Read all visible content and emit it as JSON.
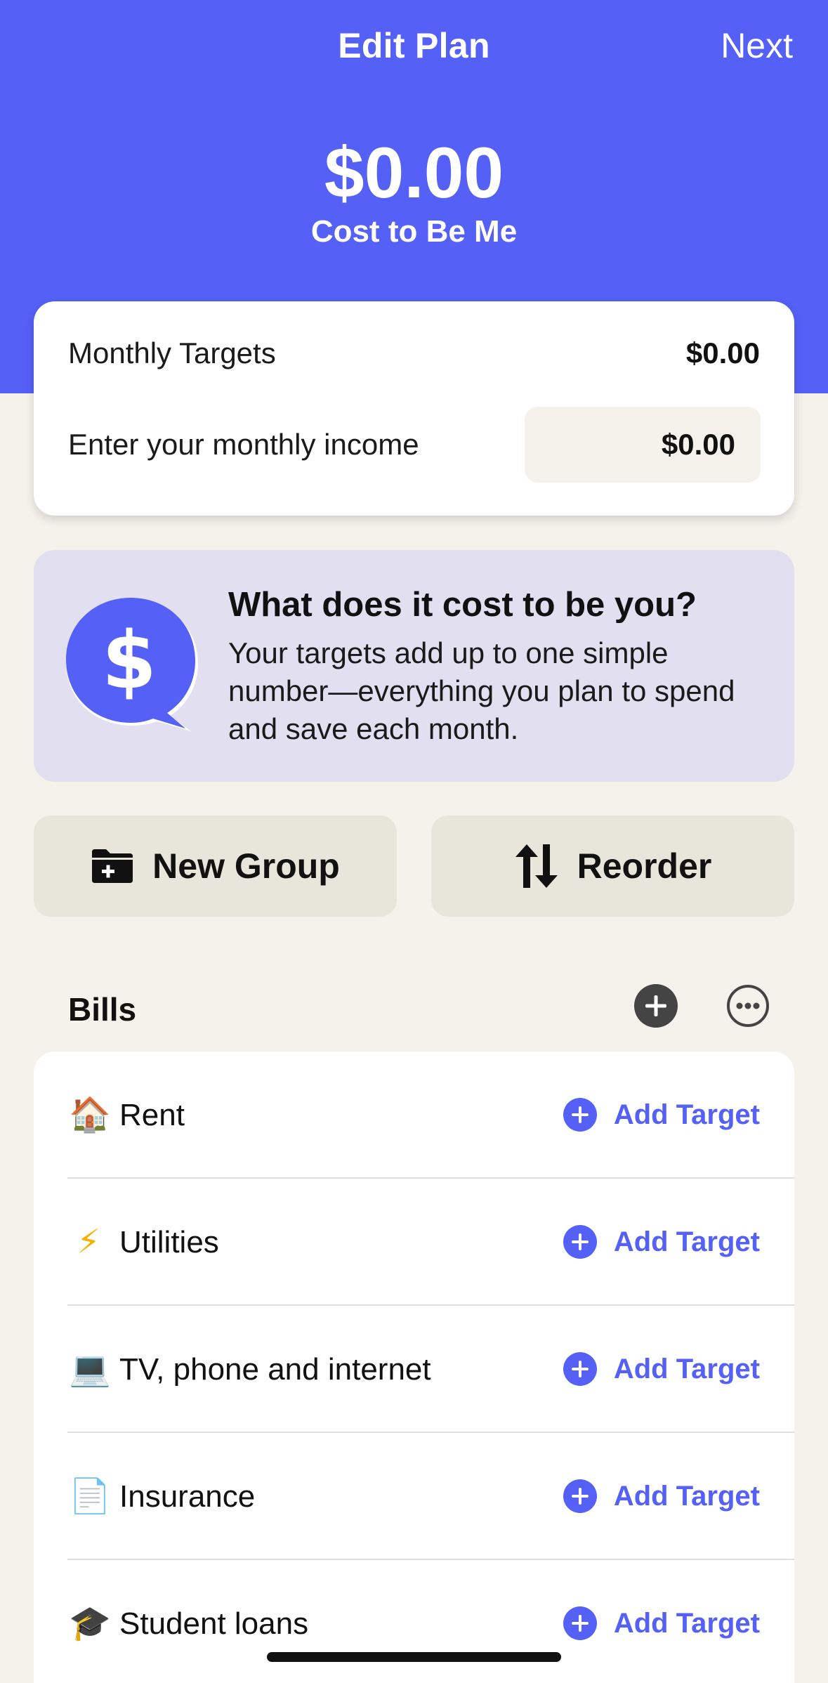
{
  "nav": {
    "title": "Edit Plan",
    "next_label": "Next"
  },
  "hero": {
    "amount": "$0.00",
    "label": "Cost to Be Me"
  },
  "summary": {
    "monthly_targets_label": "Monthly Targets",
    "monthly_targets_value": "$0.00",
    "income_label": "Enter your monthly income",
    "income_value": "$0.00"
  },
  "info": {
    "icon": "dollar-speech-bubble-icon",
    "title": "What does it cost to be you?",
    "body": "Your targets add up to one simple number—everything you plan to spend and save each month."
  },
  "actions": {
    "new_group_label": "New Group",
    "reorder_label": "Reorder"
  },
  "group": {
    "title": "Bills",
    "items": [
      {
        "emoji": "🏠",
        "name": "Rent",
        "action": "Add Target"
      },
      {
        "emoji": "⚡",
        "name": "Utilities",
        "action": "Add Target"
      },
      {
        "emoji": "💻",
        "name": "TV, phone and internet",
        "action": "Add Target"
      },
      {
        "emoji": "📄",
        "name": "Insurance",
        "action": "Add Target"
      },
      {
        "emoji": "🎓",
        "name": "Student loans",
        "action": "Add Target"
      }
    ]
  },
  "colors": {
    "accent": "#5460f6",
    "background": "#f4f2ea",
    "banner": "#e1dff0",
    "button_bg": "#e8e5da"
  }
}
